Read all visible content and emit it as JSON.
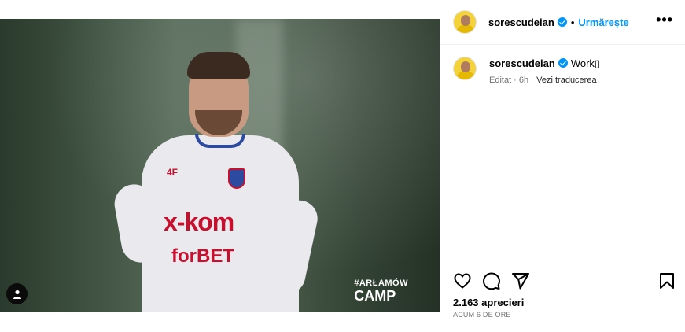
{
  "post": {
    "author": "sorescudeian",
    "verified": true,
    "follow_label": "Urmărește",
    "separator": "•",
    "more_label": "•••",
    "caption_author": "sorescudeian",
    "caption_text": "Work▯",
    "edited_label": "Editat · 6h",
    "translate_label": "Vezi traducerea",
    "likes": "2.163 aprecieri",
    "timestamp": "ACUM 6 DE ORE"
  },
  "media": {
    "jersey_brand": "4F",
    "sponsor_main": "x-kom",
    "sponsor_secondary": "forBET",
    "watermark_tag": "#ARŁAMÓW",
    "watermark_title": "CAMP"
  },
  "icons": {
    "verified": "verified-badge-icon",
    "like": "heart-icon",
    "comment": "comment-icon",
    "share": "share-icon",
    "save": "bookmark-icon",
    "more": "more-options-icon",
    "tagged": "tagged-user-icon"
  },
  "colors": {
    "accent": "#0095f6",
    "secondary_text": "#737373",
    "divider": "#dbdbdb"
  }
}
